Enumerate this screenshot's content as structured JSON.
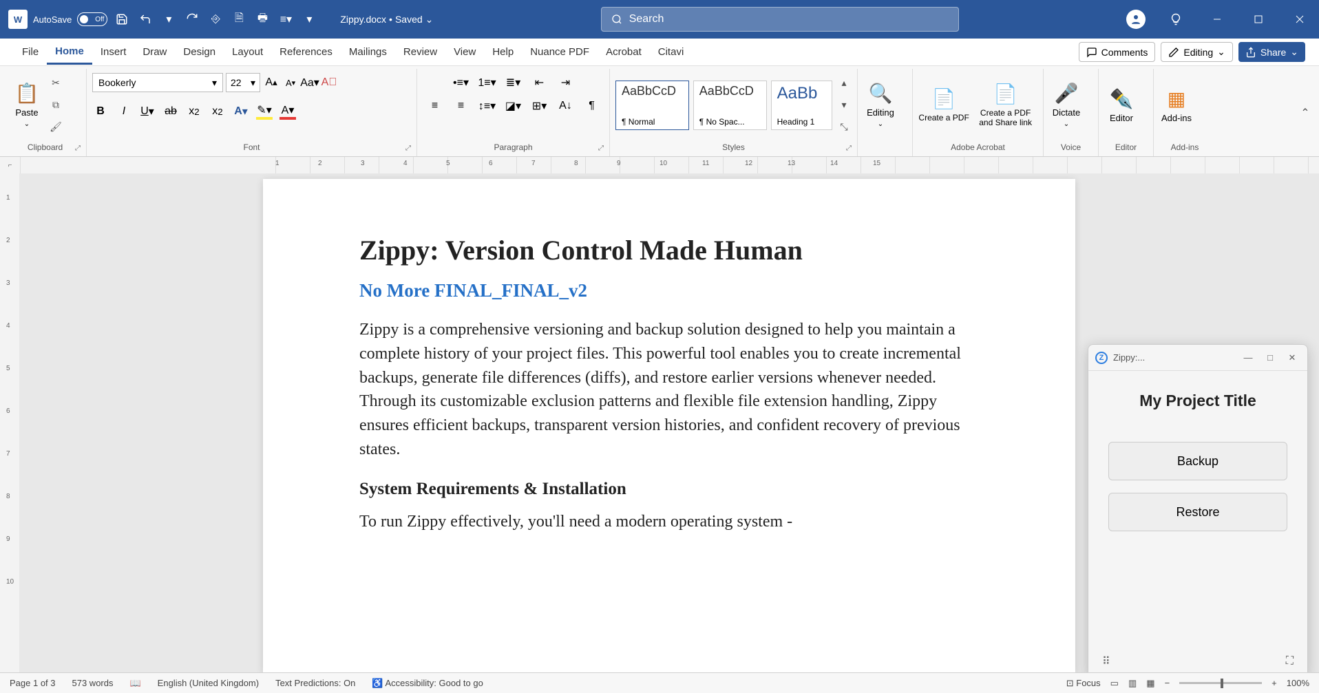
{
  "titlebar": {
    "autosave_label": "AutoSave",
    "autosave_state": "Off",
    "filename": "Zippy.docx",
    "saved_state": "Saved",
    "search_placeholder": "Search"
  },
  "tabs": {
    "file": "File",
    "home": "Home",
    "insert": "Insert",
    "draw": "Draw",
    "design": "Design",
    "layout": "Layout",
    "references": "References",
    "mailings": "Mailings",
    "review": "Review",
    "view": "View",
    "help": "Help",
    "nuance": "Nuance PDF",
    "acrobat": "Acrobat",
    "citavi": "Citavi",
    "comments": "Comments",
    "editing": "Editing",
    "share": "Share"
  },
  "ribbon": {
    "paste": "Paste",
    "clipboard": "Clipboard",
    "font_name": "Bookerly",
    "font_size": "22",
    "font": "Font",
    "paragraph": "Paragraph",
    "style_normal_prev": "AaBbCcD",
    "style_normal": "¶ Normal",
    "style_nospacing_prev": "AaBbCcD",
    "style_nospacing": "¶ No Spac...",
    "style_heading1_prev": "AaBb",
    "style_heading1": "Heading 1",
    "styles": "Styles",
    "editing_label": "Editing",
    "create_pdf": "Create a PDF",
    "create_pdf_share": "Create a PDF and Share link",
    "adobe": "Adobe Acrobat",
    "dictate": "Dictate",
    "voice": "Voice",
    "editor": "Editor",
    "editor_grp": "Editor",
    "addins": "Add-ins",
    "addins_grp": "Add-ins"
  },
  "ruler_h": [
    "1",
    "2",
    "3",
    "4",
    "5",
    "6",
    "7",
    "8",
    "9",
    "10",
    "11",
    "12",
    "13",
    "14",
    "15"
  ],
  "ruler_v": [
    "1",
    "2",
    "3",
    "4",
    "5",
    "6",
    "7",
    "8",
    "9",
    "10"
  ],
  "document": {
    "h1": "Zippy: Version Control Made Human",
    "h2": "No More FINAL_FINAL_v2",
    "p1": "Zippy is a comprehensive versioning and backup solution designed to help you maintain a complete history of your project files. This powerful tool enables you to create incremental backups, generate file differences (diffs), and restore earlier versions whenever needed. Through its customizable exclusion patterns and flexible file extension handling, Zippy ensures efficient backups, transparent version histories, and confident recovery of previous states.",
    "h3": "System Requirements & Installation",
    "p2": "To run Zippy effectively, you'll need a modern operating system -"
  },
  "zippy_pane": {
    "window_title": "Zippy:...",
    "heading": "My Project Title",
    "backup": "Backup",
    "restore": "Restore"
  },
  "statusbar": {
    "page": "Page 1 of 3",
    "words": "573 words",
    "lang": "English (United Kingdom)",
    "predictions": "Text Predictions: On",
    "accessibility": "Accessibility: Good to go",
    "focus": "Focus",
    "zoom": "100%"
  }
}
